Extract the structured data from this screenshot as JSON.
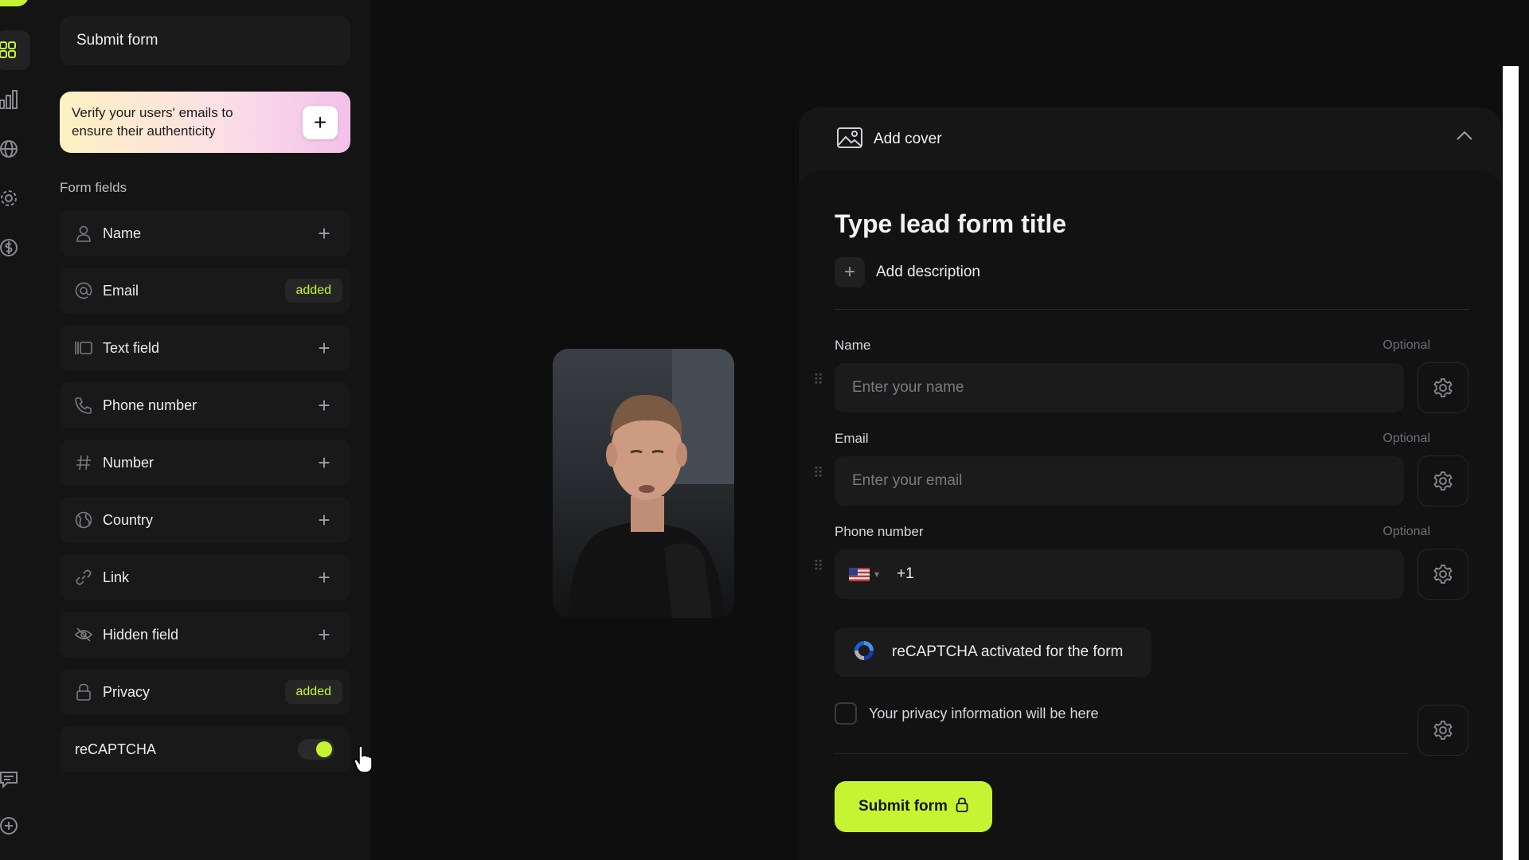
{
  "colors": {
    "accent": "#c6f432",
    "background": "#0e0e0f",
    "panel": "#141415"
  },
  "rail": {
    "icons": [
      "dashboard-icon",
      "bar-chart-icon",
      "globe-icon",
      "gear-icon",
      "dollar-icon",
      "chat-icon",
      "add-circle-icon"
    ]
  },
  "panel": {
    "top_button": "Submit form",
    "promo": {
      "text": "Verify your users' emails to ensure their authenticity",
      "plus": "+"
    },
    "section_label": "Form fields",
    "fields": [
      {
        "label": "Name",
        "icon": "person-icon",
        "state": "add"
      },
      {
        "label": "Email",
        "icon": "at-icon",
        "state": "added",
        "badge": "added"
      },
      {
        "label": "Text field",
        "icon": "text-field-icon",
        "state": "add"
      },
      {
        "label": "Phone number",
        "icon": "phone-icon",
        "state": "add"
      },
      {
        "label": "Number",
        "icon": "hash-icon",
        "state": "add"
      },
      {
        "label": "Country",
        "icon": "globe-icon",
        "state": "add"
      },
      {
        "label": "Link",
        "icon": "link-icon",
        "state": "add"
      },
      {
        "label": "Hidden field",
        "icon": "eye-off-icon",
        "state": "add"
      },
      {
        "label": "Privacy",
        "icon": "lock-icon",
        "state": "added",
        "badge": "added"
      }
    ],
    "add_symbol": "+",
    "recaptcha": {
      "label": "reCAPTCHA",
      "enabled": true
    }
  },
  "form": {
    "cover_label": "Add cover",
    "title": "Type lead form title",
    "add_description": "Add description",
    "fields": {
      "name": {
        "label": "Name",
        "optional": "Optional",
        "placeholder": "Enter your name"
      },
      "email": {
        "label": "Email",
        "optional": "Optional",
        "placeholder": "Enter your email"
      },
      "phone": {
        "label": "Phone number",
        "optional": "Optional",
        "code": "+1"
      }
    },
    "recaptcha_notice": "reCAPTCHA activated for the form",
    "privacy_text": "Your privacy information will be here",
    "submit_label": "Submit form"
  }
}
